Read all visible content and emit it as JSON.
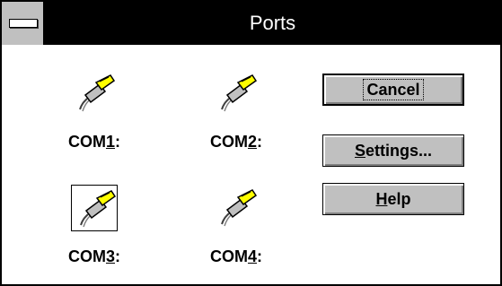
{
  "window": {
    "title": "Ports"
  },
  "ports": [
    {
      "prefix": "COM",
      "mnemonic": "1",
      "suffix": ":",
      "selected": false
    },
    {
      "prefix": "COM",
      "mnemonic": "2",
      "suffix": ":",
      "selected": false
    },
    {
      "prefix": "COM",
      "mnemonic": "3",
      "suffix": ":",
      "selected": true
    },
    {
      "prefix": "COM",
      "mnemonic": "4",
      "suffix": ":",
      "selected": false
    }
  ],
  "buttons": {
    "cancel": {
      "label": "Cancel"
    },
    "settings": {
      "mnemonic": "S",
      "rest": "ettings..."
    },
    "help": {
      "mnemonic": "H",
      "rest": "elp"
    }
  },
  "icons": {
    "system_menu": "system-menu-icon",
    "port": "serial-port-connector-icon"
  },
  "colors": {
    "titlebar": "#000000",
    "title_text": "#ffffff",
    "button_face": "#c0c0c0",
    "connector": "#ffff00"
  }
}
